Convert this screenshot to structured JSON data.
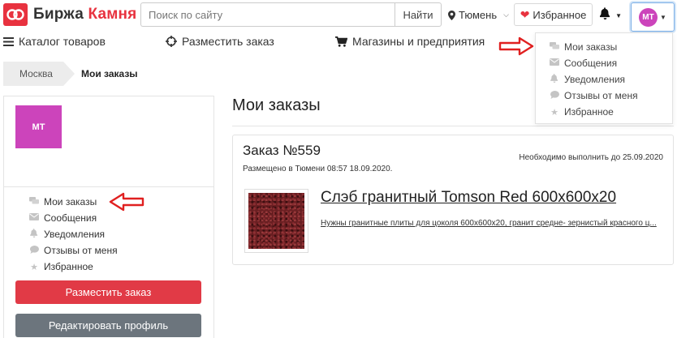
{
  "header": {
    "logo_text_1": "Биржа",
    "logo_text_2": "Камня",
    "search_placeholder": "Поиск по сайту",
    "search_button": "Найти",
    "city": "Тюмень",
    "favorites_button": "Избранное",
    "user_initials": "МТ"
  },
  "nav": {
    "catalog": "Каталог товаров",
    "place_order": "Разместить заказ",
    "shops": "Магазины и предприятия"
  },
  "dropdown": {
    "items": [
      {
        "label": "Мои заказы",
        "icon": "comments-icon"
      },
      {
        "label": "Сообщения",
        "icon": "envelope-icon"
      },
      {
        "label": "Уведомления",
        "icon": "bell-icon"
      },
      {
        "label": "Отзывы от меня",
        "icon": "comment-icon"
      },
      {
        "label": "Избранное",
        "icon": "star-icon"
      }
    ]
  },
  "breadcrumb": {
    "city": "Москва",
    "current": "Мои заказы"
  },
  "sidebar": {
    "avatar_initials": "МТ",
    "menu": [
      {
        "label": "Мои заказы",
        "icon": "comments-icon"
      },
      {
        "label": "Сообщения",
        "icon": "envelope-icon"
      },
      {
        "label": "Уведомления",
        "icon": "bell-icon"
      },
      {
        "label": "Отзывы от меня",
        "icon": "comment-icon"
      },
      {
        "label": "Избранное",
        "icon": "star-icon"
      }
    ],
    "place_order_button": "Разместить заказ",
    "edit_profile_button": "Редактировать профиль"
  },
  "main": {
    "title": "Мои заказы",
    "order": {
      "number": "Заказ №559",
      "placed": "Размещено в Тюмени 08:57 18.09.2020.",
      "due": "Необходимо выполнить до 25.09.2020",
      "product_title": "Слэб гранитный Tomson Red 600х600х20",
      "product_desc": "Нужны гранитные плиты для цоколя 600х600х20, гранит средне- зернистый красного ц..."
    }
  },
  "colors": {
    "brand_red": "#e8323f",
    "avatar_purple": "#cc44bb",
    "secondary_gray": "#6c757d",
    "annotation_red": "#e02020"
  }
}
